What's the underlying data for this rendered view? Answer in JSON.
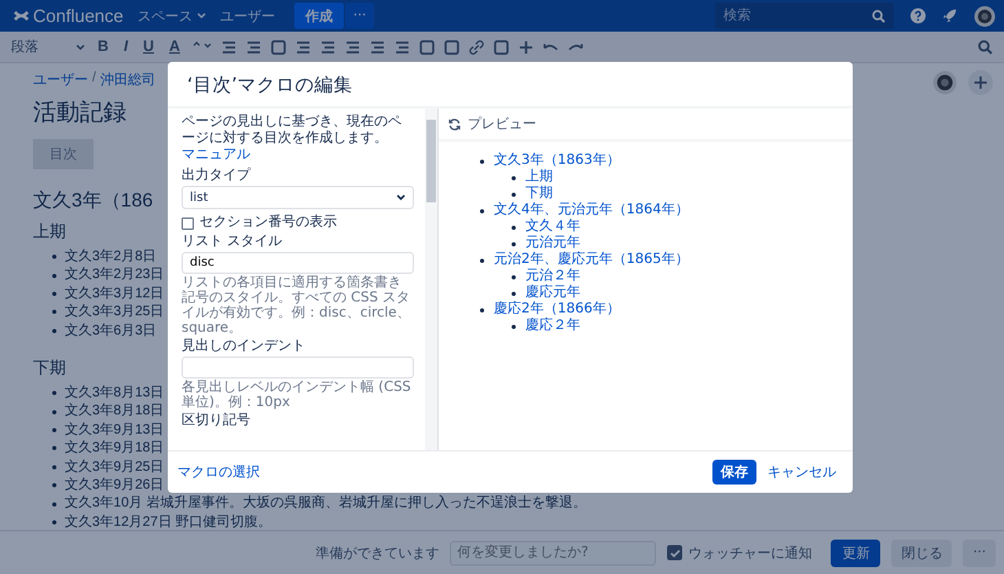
{
  "topbar": {
    "logo": "Confluence",
    "nav": [
      {
        "label": "スペース",
        "dropdown": true
      },
      {
        "label": "ユーザー",
        "dropdown": false
      }
    ],
    "create": "作成",
    "more": "···",
    "search": {
      "placeholder": "検索"
    }
  },
  "toolbar": {
    "paragraph": "段落",
    "format": [
      "B",
      "I",
      "U",
      "A"
    ]
  },
  "page": {
    "breadcrumbs": [
      "ユーザー",
      "沖田総司"
    ],
    "separator": "/",
    "title": "活動記録",
    "macro": "目次",
    "sections": [
      {
        "kind": "h1",
        "text": "文久3年（186"
      },
      {
        "kind": "h2",
        "text": "上期"
      },
      {
        "kind": "list",
        "items": [
          "文久3年2月8日",
          "文久3年2月23日",
          "文久3年3月12日",
          "文久3年3月25日",
          "文久3年6月3日"
        ]
      },
      {
        "kind": "h2",
        "text": "下期"
      },
      {
        "kind": "list",
        "items": [
          "文久3年8月13日",
          "文久3年8月18日",
          "文久3年9月13日",
          "文久3年9月18日",
          "文久3年9月25日",
          "文久3年9月26日",
          "文久3年10月 岩城升屋事件。大坂の呉服商、岩城升屋に押し入った不逞浪士を撃退。",
          "文久3年12月27日 野口健司切腹。"
        ]
      }
    ]
  },
  "bottom": {
    "status": "準備ができています",
    "comment": {
      "placeholder": "何を変更しましたか?"
    },
    "notify": {
      "label": "ウォッチャーに通知",
      "checked": true
    },
    "update": "更新",
    "close": "閉じる",
    "more": "···"
  },
  "modal": {
    "title": "‘目次’マクロの編集",
    "description": "ページの見出しに基づき、現在のページに対する目次を作成します。",
    "link": "マニュアル",
    "fields": [
      {
        "kind": "select",
        "label": "出力タイプ",
        "value": "list"
      },
      {
        "kind": "checkbox",
        "label": "セクション番号の表示",
        "checked": false
      },
      {
        "kind": "text",
        "label": "リスト スタイル",
        "value": "disc",
        "help": "リストの各項目に適用する箇条書き記号のスタイル。すべての CSS スタイルが有効です。例：disc、circle、square。"
      },
      {
        "kind": "text",
        "label": "見出しのインデント",
        "help": "各見出しレベルのインデント幅 (CSS 単位)。例：10px"
      },
      {
        "kind": "label",
        "label": "区切り記号"
      }
    ],
    "preview": {
      "title": "プレビュー",
      "toc": [
        {
          "text": "文久3年（1863年）",
          "children": [
            {
              "text": "上期"
            },
            {
              "text": "下期"
            }
          ]
        },
        {
          "text": "文久4年、元治元年（1864年）",
          "children": [
            {
              "text": "文久４年"
            },
            {
              "text": "元治元年"
            }
          ]
        },
        {
          "text": "元治2年、慶応元年（1865年）",
          "children": [
            {
              "text": "元治２年"
            },
            {
              "text": "慶応元年"
            }
          ]
        },
        {
          "text": "慶応2年（1866年）",
          "children": [
            {
              "text": "慶応２年"
            }
          ]
        }
      ]
    },
    "select_macro": "マクロの選択",
    "save": "保存",
    "cancel": "キャンセル"
  }
}
